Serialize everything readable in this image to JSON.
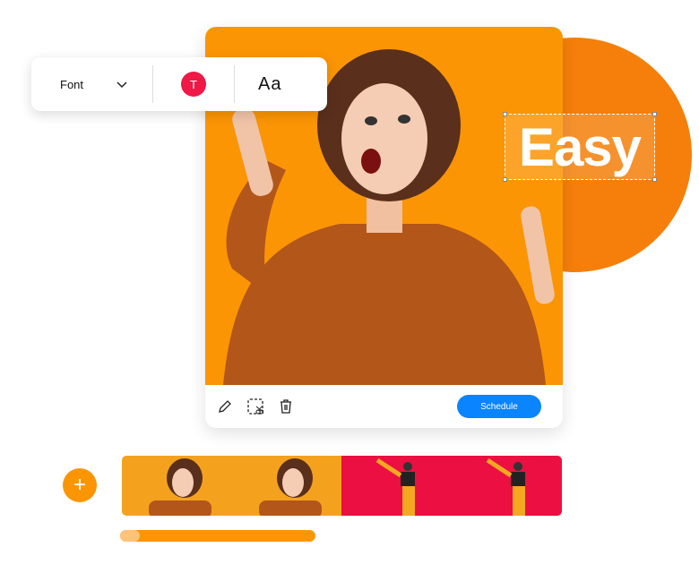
{
  "toolbar": {
    "font_label": "Font",
    "color_letter": "T",
    "text_style_label": "Aa"
  },
  "canvas": {
    "overlay_text": "Easy"
  },
  "card_actions": {
    "schedule_label": "Schedule",
    "icons": [
      "pencil-icon",
      "crop-scissors-icon",
      "trash-icon"
    ]
  },
  "timeline": {
    "add_label": "+",
    "progress_percent": 8
  },
  "colors": {
    "accent_orange": "#fb9504",
    "circle_orange": "#f57f0a",
    "red": "#ef1846",
    "blue": "#0a84ff"
  }
}
